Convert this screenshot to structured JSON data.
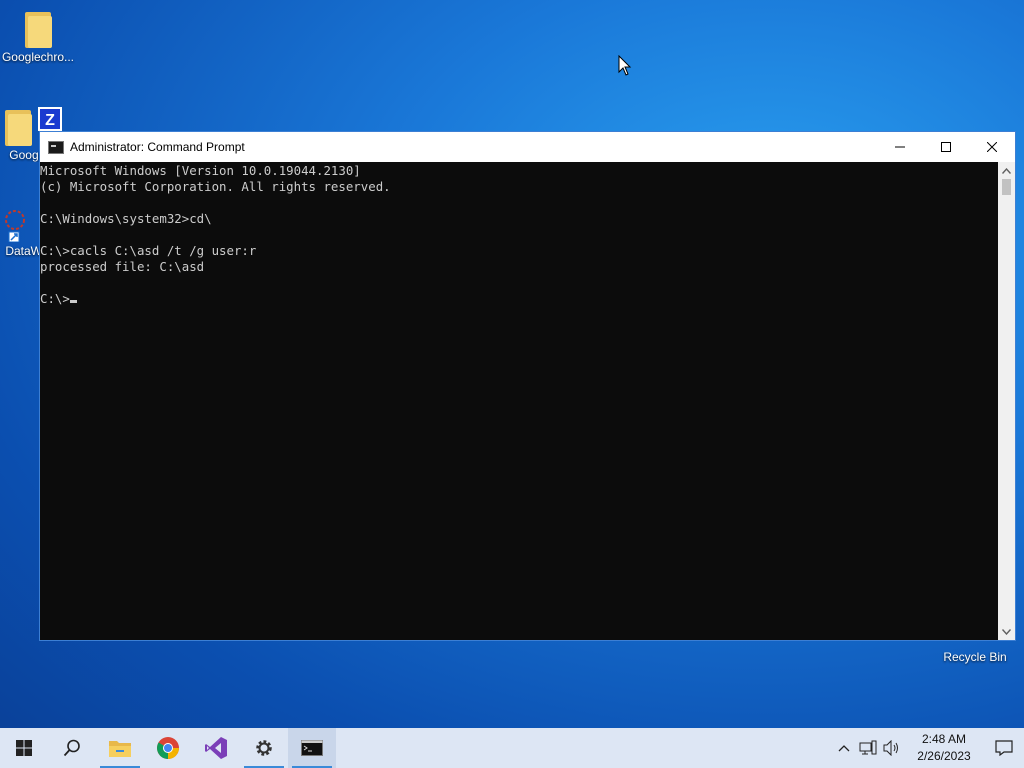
{
  "desktop": {
    "icons": [
      {
        "label": "Googlechro..."
      },
      {
        "label": "Google"
      },
      {
        "label": "DataW"
      }
    ],
    "zip_badge_letter": "Z",
    "recycle_bin_label": "Recycle Bin"
  },
  "window": {
    "title": "Administrator: Command Prompt",
    "console_lines": [
      "Microsoft Windows [Version 10.0.19044.2130]",
      "(c) Microsoft Corporation. All rights reserved.",
      "",
      "C:\\Windows\\system32>cd\\",
      "",
      "C:\\>cacls C:\\asd /t /g user:r",
      "processed file: C:\\asd",
      "",
      "C:\\>"
    ]
  },
  "taskbar": {
    "items": [
      "start",
      "search",
      "file-explorer",
      "chrome",
      "visual-studio",
      "settings",
      "command-prompt"
    ],
    "clock_time": "2:48 AM",
    "clock_date": "2/26/2023"
  },
  "colors": {
    "console_bg": "#0c0c0c",
    "console_fg": "#cccccc",
    "taskbar_bg": "#dde6f4"
  }
}
